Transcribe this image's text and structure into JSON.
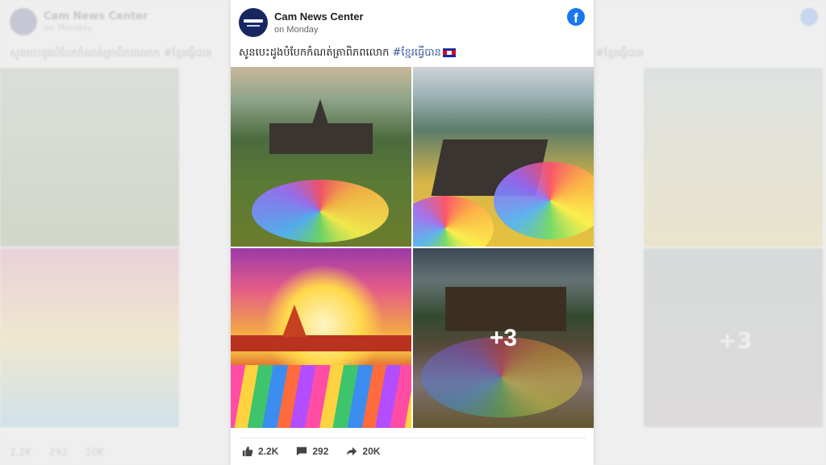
{
  "post": {
    "author": "Cam News Center",
    "time": "on Monday",
    "caption_text": "សូនបេះដូងបំបែកកំណត់ត្រាពិភពលោក ",
    "hashtag": "#ខ្មែរធ្វើបាន",
    "more_photos": "+3",
    "stats": {
      "likes": "2.2K",
      "comments": "292",
      "shares": "20K"
    }
  },
  "icons": {
    "facebook": "facebook-icon",
    "like": "thumbs-up-icon",
    "comment": "comment-icon",
    "share": "share-arrow-icon",
    "flag": "cambodia-flag-icon"
  },
  "colors": {
    "facebook_blue": "#1877f2",
    "hashtag": "#385898",
    "avatar": "#162760"
  }
}
